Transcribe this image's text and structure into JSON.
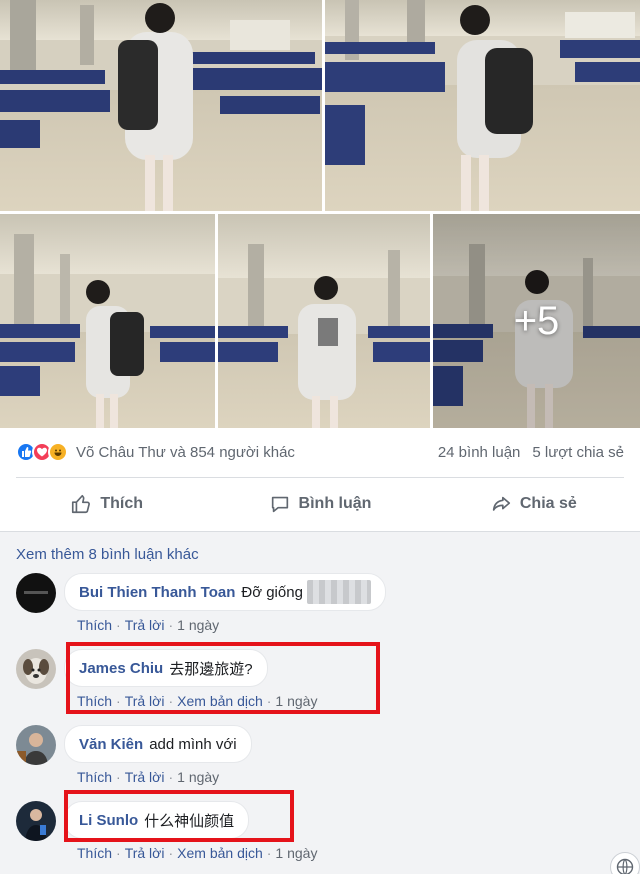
{
  "photos": {
    "more_count": "+5"
  },
  "reactions": {
    "icons": [
      "like-icon",
      "love-icon",
      "haha-icon"
    ],
    "colors": {
      "like": "#1877f2",
      "love": "#f33e58",
      "haha": "#f7b125"
    },
    "names": "Võ Châu Thư và 854 người khác",
    "comments_count": "24 bình luận",
    "shares_count": "5 lượt chia sẻ"
  },
  "actions": {
    "like": "Thích",
    "comment": "Bình luận",
    "share": "Chia sẻ"
  },
  "comments_section": {
    "view_more": "Xem thêm 8 bình luận khác",
    "items": [
      {
        "author": "Bui Thien Thanh Toan",
        "text": "Đỡ giống",
        "like": "Thích",
        "reply": "Trả lời",
        "time": "1 ngày"
      },
      {
        "author": "James Chiu",
        "text": "去那邊旅遊?",
        "like": "Thích",
        "reply": "Trả lời",
        "translate": "Xem bản dịch",
        "time": "1 ngày"
      },
      {
        "author": "Văn Kiên",
        "text": "add mình với",
        "like": "Thích",
        "reply": "Trả lời",
        "time": "1 ngày"
      },
      {
        "author": "Li Sunlo",
        "text": "什么神仙颜值",
        "like": "Thích",
        "reply": "Trả lời",
        "translate": "Xem bản dịch",
        "time": "1 ngày"
      }
    ]
  },
  "colors": {
    "link": "#385898",
    "highlight": "#e5131a",
    "muted": "#606770"
  }
}
